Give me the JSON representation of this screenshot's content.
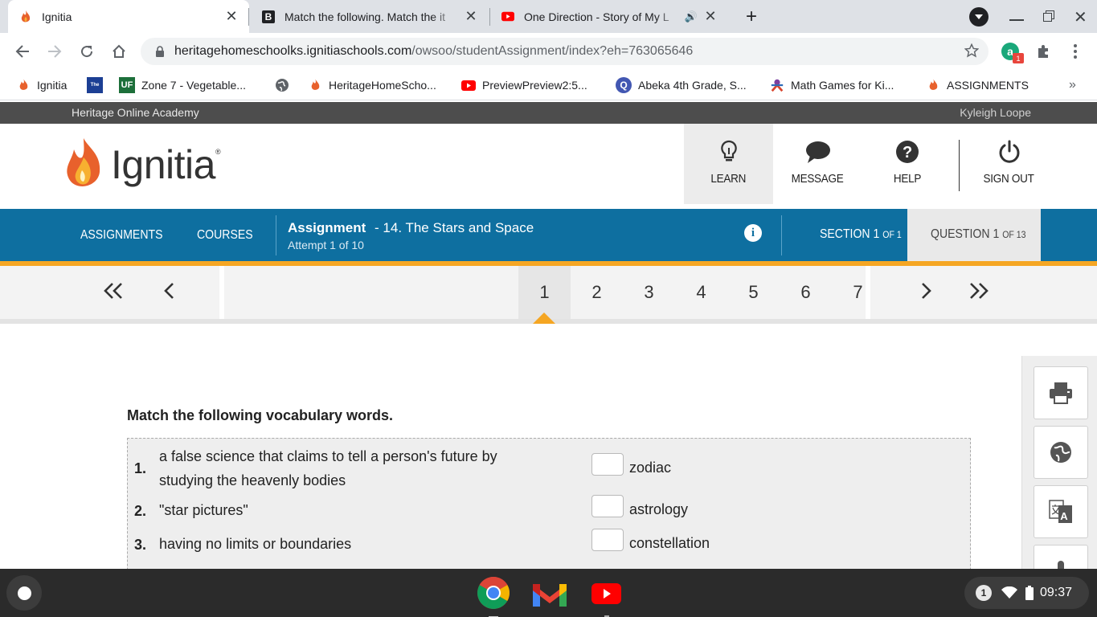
{
  "browser": {
    "tabs": [
      {
        "title": "Ignitia",
        "icon": "ignitia-flame-icon",
        "active": true
      },
      {
        "title": "Match the following. Match the it",
        "icon": "brainly-icon",
        "active": false
      },
      {
        "title": "One Direction - Story of My L",
        "icon": "youtube-icon",
        "active": false,
        "audio": true
      }
    ],
    "url_host": "heritagehomeschoolks.ignitiaschools.com",
    "url_path": "/owsoo/studentAssignment/index?eh=763065646",
    "extension_badge": "1",
    "bookmarks": [
      {
        "label": "Ignitia",
        "icon": "ignitia-flame-icon"
      },
      {
        "label": "",
        "icon": "weather-channel-icon"
      },
      {
        "label": "Zone 7 - Vegetable...",
        "icon": "uf-icon"
      },
      {
        "label": "",
        "icon": "globe-icon"
      },
      {
        "label": "HeritageHomeScho...",
        "icon": "ignitia-flame-icon"
      },
      {
        "label": "PreviewPreview2:5...",
        "icon": "youtube-icon"
      },
      {
        "label": "Abeka 4th Grade, S...",
        "icon": "quizlet-icon"
      },
      {
        "label": "Math Games for Ki...",
        "icon": "math-games-icon"
      },
      {
        "label": "ASSIGNMENTS",
        "icon": "ignitia-flame-icon"
      }
    ],
    "more_bookmarks": "»"
  },
  "org": {
    "name": "Heritage Online Academy",
    "user": "Kyleigh Loope"
  },
  "logo": {
    "text": "Ignitia",
    "mark": "®"
  },
  "header_nav": [
    {
      "label": "LEARN",
      "icon": "lightbulb-icon",
      "active": true
    },
    {
      "label": "MESSAGE",
      "icon": "speech-bubble-icon",
      "active": false
    },
    {
      "label": "HELP",
      "icon": "help-icon",
      "active": false
    },
    {
      "label": "SIGN OUT",
      "icon": "power-icon",
      "active": false
    }
  ],
  "bluebar": {
    "assignments": "ASSIGNMENTS",
    "courses": "COURSES",
    "assignment_label": "Assignment",
    "assignment_title": "- 14. The Stars and Space",
    "attempt": "Attempt 1 of 10",
    "section": "SECTION 1",
    "section_of": "OF 1",
    "question": "QUESTION 1",
    "question_of": "OF 13"
  },
  "pager": {
    "first": "«",
    "prev": "‹",
    "next": "›",
    "last": "»",
    "pages": [
      "1",
      "2",
      "3",
      "4",
      "5",
      "6",
      "7"
    ],
    "current": "1"
  },
  "question": {
    "prompt": "Match the following vocabulary words.",
    "items": [
      {
        "num": "1.",
        "line1": "a false science that claims to tell a person's future by",
        "line2": "studying the heavenly bodies"
      },
      {
        "num": "2.",
        "line1": "\"star pictures\"",
        "line2": ""
      },
      {
        "num": "3.",
        "line1": "having no limits or boundaries",
        "line2": ""
      }
    ],
    "answers": [
      "zodiac",
      "astrology",
      "constellation"
    ]
  },
  "side_tools": [
    {
      "icon": "printer-icon"
    },
    {
      "icon": "globe-icon"
    },
    {
      "icon": "translate-icon"
    },
    {
      "icon": "microphone-icon"
    }
  ],
  "shelf": {
    "notification_count": "1",
    "time": "09:37",
    "apps": [
      "chrome-icon",
      "gmail-icon",
      "youtube-icon"
    ]
  },
  "colors": {
    "blue": "#0e6fa0",
    "orange": "#f5a623",
    "dark": "#4d4d4d"
  }
}
